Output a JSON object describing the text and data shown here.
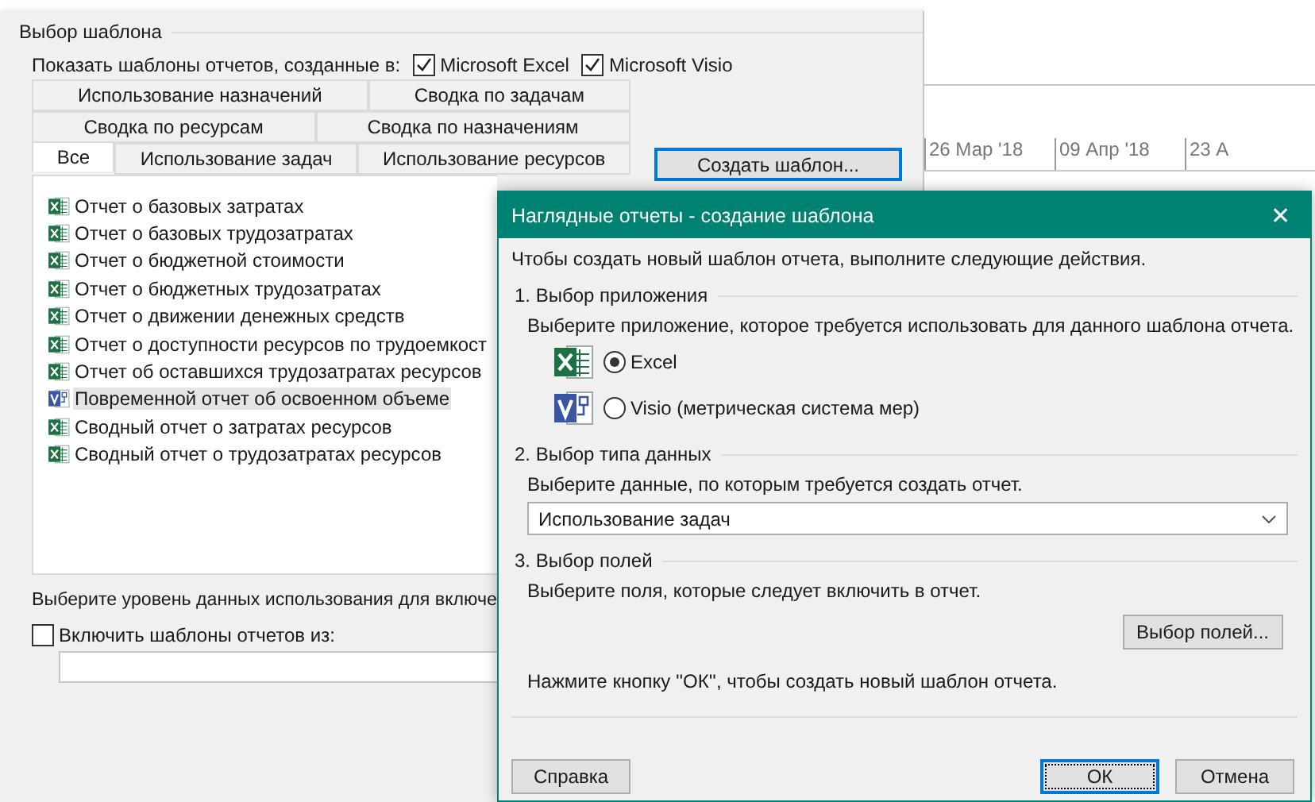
{
  "template_panel": {
    "group_title": "Выбор шаблона",
    "show_label": "Показать шаблоны отчетов, созданные в:",
    "app_filters": [
      {
        "label": "Microsoft Excel",
        "checked": true
      },
      {
        "label": "Microsoft Visio",
        "checked": true
      }
    ],
    "tab_rows": [
      [
        {
          "label": "Использование назначений",
          "selected": false
        },
        {
          "label": "Сводка по задачам",
          "selected": false
        }
      ],
      [
        {
          "label": "Сводка по ресурсам",
          "selected": false
        },
        {
          "label": "Сводка по назначениям",
          "selected": false
        }
      ],
      [
        {
          "label": "Все",
          "selected": true
        },
        {
          "label": "Использование задач",
          "selected": false
        },
        {
          "label": "Использование ресурсов",
          "selected": false
        }
      ]
    ],
    "create_button": "Создать шаблон...",
    "templates": [
      {
        "label": "Отчет о базовых затратах",
        "kind": "excel",
        "selected": false
      },
      {
        "label": "Отчет о базовых трудозатратах",
        "kind": "excel",
        "selected": false
      },
      {
        "label": "Отчет о бюджетной стоимости",
        "kind": "excel",
        "selected": false
      },
      {
        "label": "Отчет о бюджетных трудозатратах",
        "kind": "excel",
        "selected": false
      },
      {
        "label": "Отчет о движении денежных средств",
        "kind": "excel",
        "selected": false
      },
      {
        "label": "Отчет о доступности ресурсов по трудоемкост",
        "kind": "excel",
        "selected": false
      },
      {
        "label": "Отчет об оставшихся трудозатратах ресурсов",
        "kind": "excel",
        "selected": false
      },
      {
        "label": "Повременной отчет об освоенном объеме",
        "kind": "visio",
        "selected": true
      },
      {
        "label": "Сводный отчет о затратах ресурсов",
        "kind": "excel",
        "selected": false
      },
      {
        "label": "Сводный отчет о трудозатратах ресурсов",
        "kind": "excel",
        "selected": false
      }
    ],
    "level_label": "Выберите уровень данных использования для включе",
    "include": {
      "label": "Включить шаблоны отчетов из:",
      "checked": false
    }
  },
  "timeline": {
    "dates": [
      "26 Мар '18",
      "09 Апр '18",
      "23 А"
    ]
  },
  "dialog": {
    "title": "Наглядные отчеты - создание шаблона",
    "close": "✕",
    "intro": "Чтобы создать новый шаблон отчета, выполните следующие действия.",
    "sections": [
      {
        "title": "1. Выбор приложения",
        "text": "Выберите приложение, которое требуется использовать для данного шаблона отчета."
      },
      {
        "title": "2. Выбор типа данных",
        "text": "Выберите данные, по которым требуется создать отчет."
      },
      {
        "title": "3. Выбор полей",
        "text": "Выберите поля, которые следует включить в отчет."
      }
    ],
    "apps": [
      {
        "label": "Excel",
        "kind": "excel",
        "selected": true
      },
      {
        "label": "Visio (метрическая система мер)",
        "kind": "visio",
        "selected": false
      }
    ],
    "data_type": "Использование задач",
    "fields_button": "Выбор полей...",
    "note": "Нажмите кнопку ''ОК'', чтобы создать новый шаблон отчета.",
    "buttons": [
      {
        "label": "Справка",
        "default": false
      },
      {
        "label": "ОК",
        "default": true
      },
      {
        "label": "Отмена",
        "default": false
      }
    ]
  }
}
